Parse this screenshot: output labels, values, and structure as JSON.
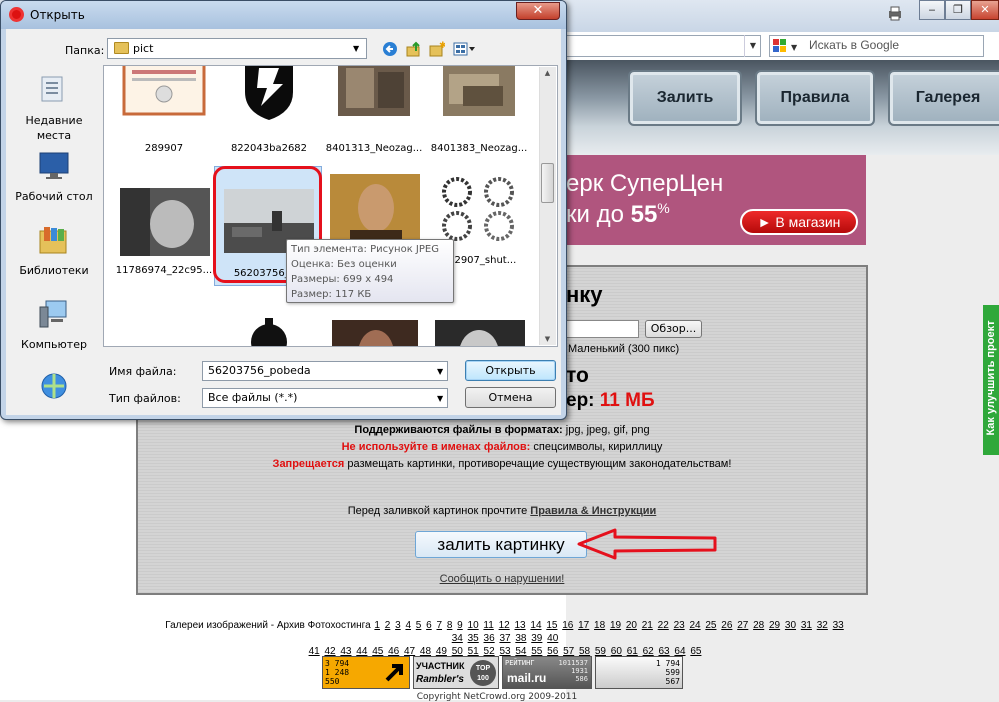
{
  "browser": {
    "search_placeholder": "Искать в Google",
    "nav": [
      "Залить",
      "Правила",
      "Галерея"
    ],
    "banner": {
      "line1": "ерк СуперЦен",
      "line2_prefix": "ки до ",
      "line2_value": "55",
      "line2_suffix": "%",
      "button": "► В магазин"
    }
  },
  "upload": {
    "title": "нку",
    "browse_button": "Обзор...",
    "size_option": "Маленький (300 пикс)",
    "photo_title": "то",
    "max_size_prefix": "ер: ",
    "max_size_value": "11 МБ",
    "formats_label": "Поддерживаются файлы в форматах:",
    "formats_value": " jpg, jpeg, gif, png",
    "no_use_label": "Не используйте в именах файлов:",
    "no_use_value": " спецсимволы, кириллицу",
    "forbidden_label": "Запрещается",
    "forbidden_value": " размещать картинки, противоречащие существующим законодательствам!",
    "before_upload": "Перед заливкой картинок прочтите ",
    "rules_link": "Правила & Инструкции",
    "upload_button": "залить картинку",
    "report_link": "Сообщить о нарушении!"
  },
  "footer": {
    "gallery_prefix": "Галереи изображений - Архив Фотохостинга",
    "pages_line1": [
      "1",
      "2",
      "3",
      "4",
      "5",
      "6",
      "7",
      "8",
      "9",
      "10",
      "11",
      "12",
      "13",
      "14",
      "15",
      "16",
      "17",
      "18",
      "19",
      "20",
      "21",
      "22",
      "23",
      "24",
      "25",
      "26",
      "27",
      "28",
      "29",
      "30",
      "31",
      "32",
      "33",
      "34",
      "35",
      "36",
      "37",
      "38",
      "39",
      "40"
    ],
    "pages_line2": [
      "41",
      "42",
      "43",
      "44",
      "45",
      "46",
      "47",
      "48",
      "49",
      "50",
      "51",
      "52",
      "53",
      "54",
      "55",
      "56",
      "57",
      "58",
      "59",
      "60",
      "61",
      "62",
      "63",
      "64",
      "65"
    ],
    "counter1": [
      "3 794",
      "1 248",
      "550"
    ],
    "counter2_top": "УЧАСТНИК",
    "counter2_bottom": "Rambler's",
    "counter2_badge": "TOP 100",
    "counter3_label": "РЕЙТИНГ",
    "counter3_values": [
      "1011537",
      "1931",
      "586"
    ],
    "counter3_brand": "mail.ru",
    "counter4": [
      "1 794",
      "599",
      "567"
    ],
    "copyright": "Copyright NetCrowd.org 2009-2011"
  },
  "feedback_tab": "Как улучшить проект",
  "dialog": {
    "title": "Открыть",
    "folder_label": "Папка:",
    "folder_value": "pict",
    "places": [
      "Недавние места",
      "Рабочий стол",
      "Библиотеки",
      "Компьютер",
      ""
    ],
    "files": [
      {
        "name": "289907"
      },
      {
        "name": "822043ba2682"
      },
      {
        "name": "8401313_Neozag..."
      },
      {
        "name": "8401383_Neozag..."
      },
      {
        "name": "11786974_22c95..."
      },
      {
        "name": "56203756_po"
      },
      {
        "name": ""
      },
      {
        "name": "292907_shut..."
      },
      {
        "name": ""
      },
      {
        "name": ""
      },
      {
        "name": ""
      },
      {
        "name": ""
      }
    ],
    "tooltip": {
      "type": "Тип элемента: Рисунок JPEG",
      "rating": "Оценка: Без оценки",
      "dimensions": "Размеры: 699 x 494",
      "size": "Размер: 117 КБ"
    },
    "filename_label": "Имя файла:",
    "filename_value": "56203756_pobeda",
    "filetype_label": "Тип файлов:",
    "filetype_value": "Все файлы (*.*)",
    "open_button": "Открыть",
    "cancel_button": "Отмена"
  }
}
